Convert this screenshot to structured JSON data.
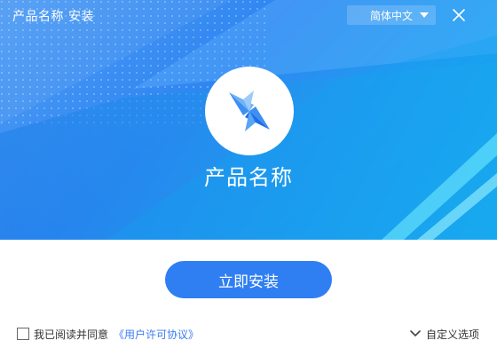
{
  "window": {
    "title": "产品名称 安装",
    "close_icon": "close-icon"
  },
  "language_select": {
    "selected": "简体中文",
    "icon": "caret-down-icon"
  },
  "hero": {
    "logo_icon": "bowtie-logo-icon",
    "product_name": "产品名称"
  },
  "actions": {
    "install_label": "立即安装"
  },
  "agreement": {
    "checked": false,
    "text": "我已阅读并同意",
    "link_text": "《用户许可协议》"
  },
  "custom_options": {
    "label": "自定义选项",
    "icon": "chevron-down-icon"
  },
  "colors": {
    "primary": "#2f7ff3",
    "link": "#3a7cf0",
    "hero_light": "#4f9cf4",
    "hero_cyan": "#12b6ee"
  }
}
